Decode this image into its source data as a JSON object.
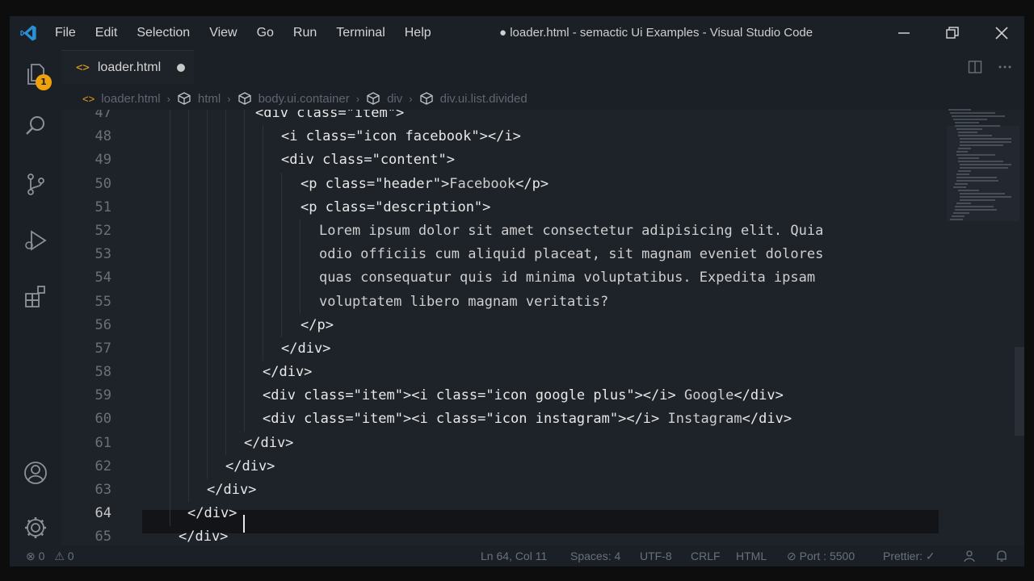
{
  "window": {
    "title": "● loader.html - semactic Ui Examples - Visual Studio Code"
  },
  "menu": [
    "File",
    "Edit",
    "Selection",
    "View",
    "Go",
    "Run",
    "Terminal",
    "Help"
  ],
  "activity": {
    "explorer_badge": "1"
  },
  "tab": {
    "icon": "<>",
    "label": "loader.html"
  },
  "breadcrumb": {
    "items": [
      "loader.html",
      "html",
      "body.ui.container",
      "div",
      "div.ui.list.divided"
    ]
  },
  "editor": {
    "lines": [
      {
        "num": "47",
        "indent": 6
      },
      {
        "num": "48",
        "indent": 7
      },
      {
        "num": "49",
        "indent": 7
      },
      {
        "num": "50",
        "indent": 8
      },
      {
        "num": "51",
        "indent": 8
      },
      {
        "num": "52",
        "indent": 9,
        "text": "Lorem ipsum dolor sit amet consectetur adipisicing elit. Quia"
      },
      {
        "num": "53",
        "indent": 9,
        "text": "odio officiis cum aliquid placeat, sit magnam eveniet dolores"
      },
      {
        "num": "54",
        "indent": 9,
        "text": "quas consequatur quis id minima voluptatibus. Expedita ipsam"
      },
      {
        "num": "55",
        "indent": 9,
        "text": "voluptatem libero magnam veritatis?"
      },
      {
        "num": "56",
        "indent": 8
      },
      {
        "num": "57",
        "indent": 7
      },
      {
        "num": "58",
        "indent": 6
      },
      {
        "num": "59",
        "indent": 6
      },
      {
        "num": "60",
        "indent": 6
      },
      {
        "num": "61",
        "indent": 5
      },
      {
        "num": "62",
        "indent": 4
      },
      {
        "num": "63",
        "indent": 3
      },
      {
        "num": "64",
        "indent": 2
      },
      {
        "num": "65",
        "indent": 1
      }
    ],
    "tokens": {
      "l47": [
        "<div class=\"item\">"
      ],
      "l48": [
        "<i class=\"icon facebook\"></i>"
      ],
      "l49": [
        "<div class=\"content\">"
      ],
      "l50_open": "<p class=\"header\">",
      "l50_text": "Facebook",
      "l50_close": "</p>",
      "l51": "<p class=\"description\">",
      "l56": "</p>",
      "l57": "</div>",
      "l58": "</div>",
      "l59_a": "<div class=\"item\"><i class=\"icon google plus\"></i>",
      "l59_text": " Google",
      "l59_b": "</div>",
      "l60_a": "<div class=\"item\"><i class=\"icon instagram\"></i>",
      "l60_text": " Instagram",
      "l60_b": "</div>",
      "l61": "</div>",
      "l62": "</div>",
      "l63": "</div>",
      "l64": "</div>",
      "l65": "</div>"
    }
  },
  "status": {
    "errors": "0",
    "warnings": "0",
    "position": "Ln 64, Col 11",
    "spaces": "Spaces: 4",
    "encoding": "UTF-8",
    "eol": "CRLF",
    "language": "HTML",
    "port": "Port : 5500",
    "prettier": "Prettier: ✓"
  }
}
